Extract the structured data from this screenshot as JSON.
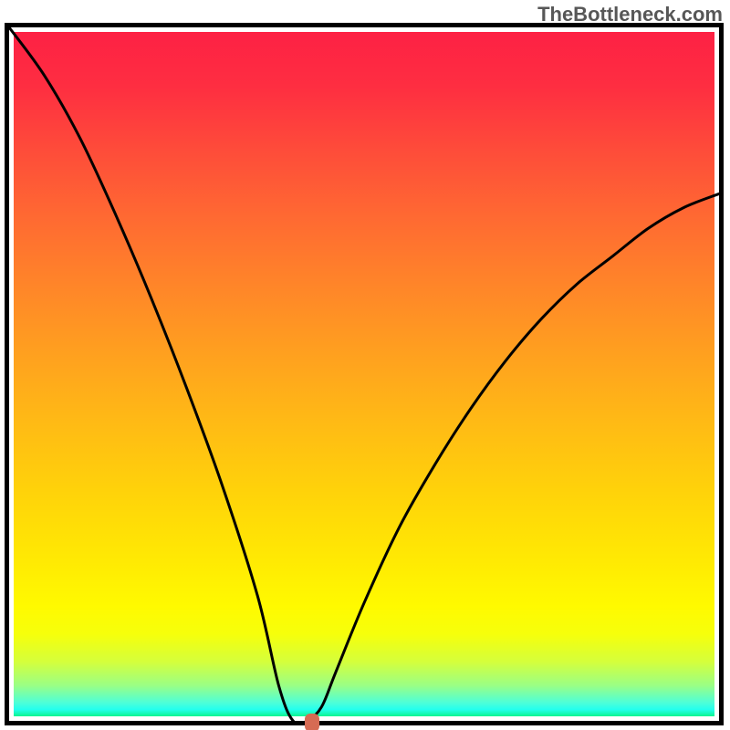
{
  "watermark": "TheBottleneck.com",
  "chart_data": {
    "type": "line",
    "title": "",
    "xlabel": "",
    "ylabel": "",
    "xlim": [
      0,
      100
    ],
    "ylim": [
      0,
      100
    ],
    "series": [
      {
        "name": "bottleneck-curve",
        "x": [
          0,
          5,
          10,
          15,
          20,
          25,
          30,
          35,
          38,
          40,
          42,
          44,
          46,
          50,
          55,
          60,
          65,
          70,
          75,
          80,
          85,
          90,
          95,
          100
        ],
        "y": [
          100,
          93,
          84,
          73,
          61,
          48,
          34,
          18,
          5,
          0,
          0,
          2,
          7,
          17,
          28,
          37,
          45,
          52,
          58,
          63,
          67,
          71,
          74,
          76
        ]
      }
    ],
    "marker": {
      "x": 42,
      "y": 0
    },
    "gradient": {
      "top": "#fd2144",
      "middle": "#ffd20a",
      "bottom": "#0bf58f"
    }
  }
}
